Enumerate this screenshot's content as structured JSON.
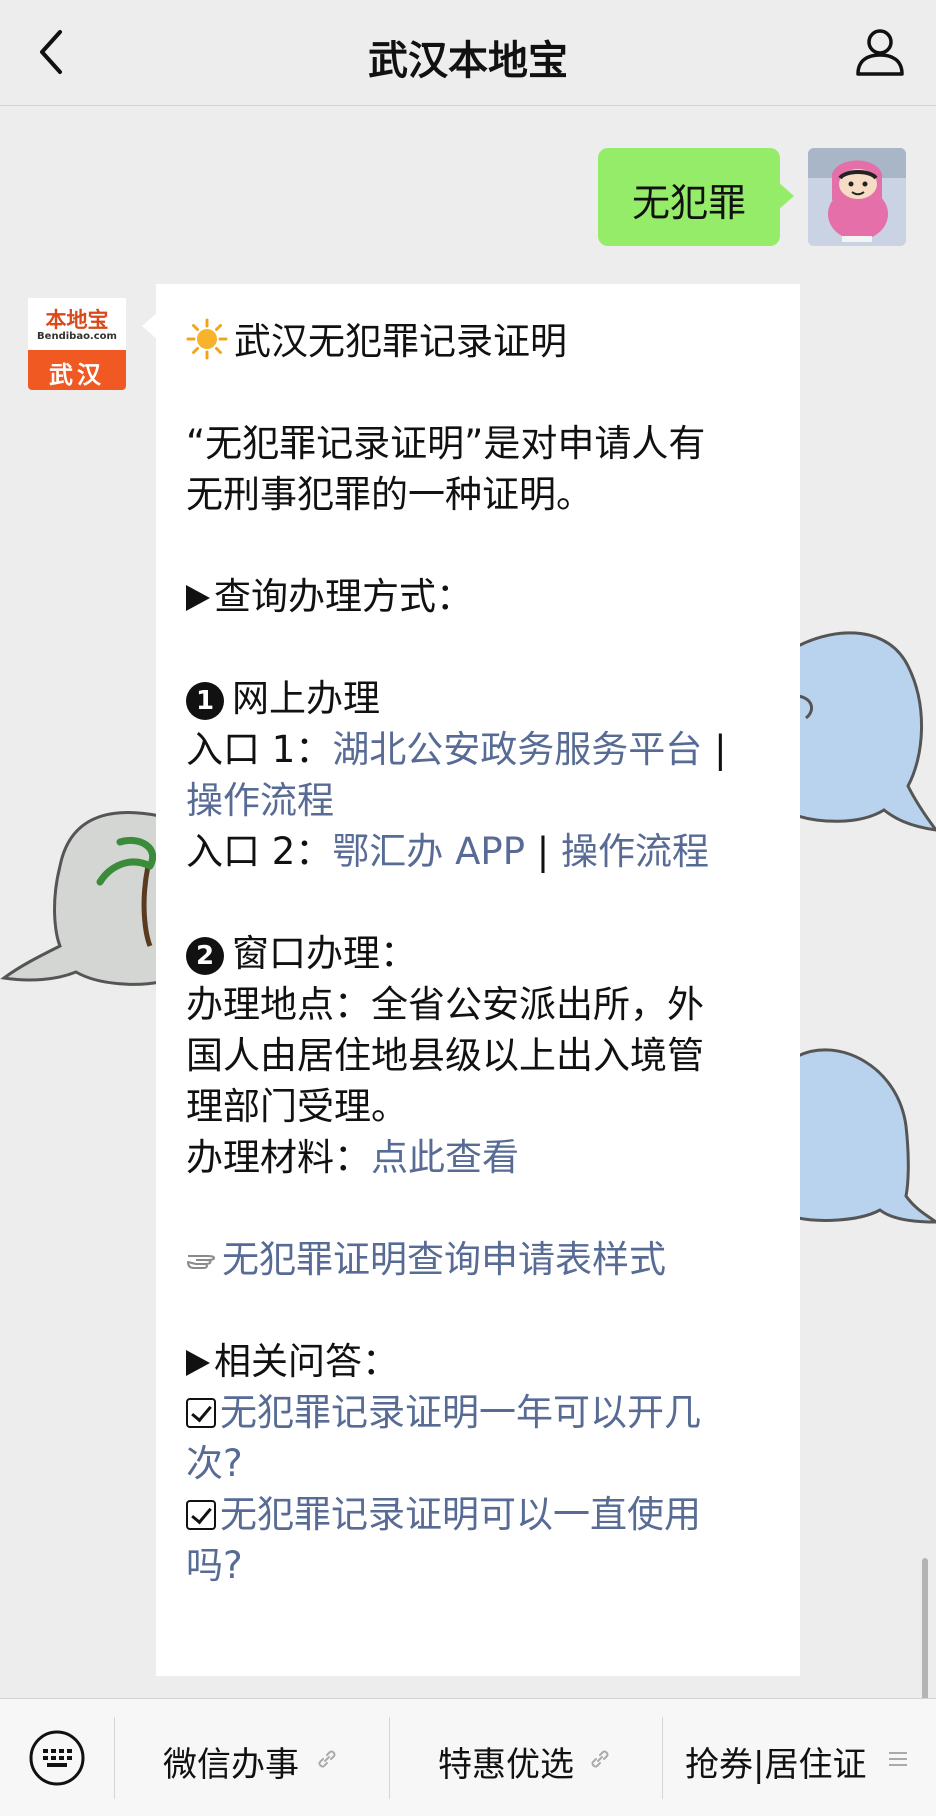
{
  "header": {
    "title": "武汉本地宝",
    "back_icon": "chevron-left-icon",
    "profile_icon": "person-icon"
  },
  "user_message": {
    "text": "无犯罪"
  },
  "bot_avatar": {
    "brand": "本地宝",
    "site": "Bendibao.com",
    "city": "武汉"
  },
  "bot_message": {
    "title": "武汉无犯罪记录证明",
    "intro_line1": "“无犯罪记录证明”是对申请人有",
    "intro_line2": "无刑事犯罪的一种证明。",
    "section_query": "查询办理方式：",
    "online_number": "1",
    "online_title": "网上办理",
    "entry1_prefix": "入口 1：",
    "entry1_link": "湖北公安政务服务平台",
    "entry1_sep": " |",
    "entry1_flow": "操作流程",
    "entry2_prefix": "入口 2：",
    "entry2_link": "鄂汇办 APP",
    "entry2_sep": " | ",
    "entry2_flow": "操作流程",
    "window_number": "2",
    "window_title": "窗口办理：",
    "location_line1": "办理地点：全省公安派出所，外",
    "location_line2": "国人由居住地县级以上出入境管",
    "location_line3": "理部门受理。",
    "material_prefix": "办理材料：",
    "material_link": "点此查看",
    "form_link": "无犯罪证明查询申请表样式",
    "section_faq": "相关问答：",
    "faq1_line1": "无犯罪记录证明一年可以开几",
    "faq1_line2": "次?",
    "faq2_line1": "无犯罪记录证明可以一直使用",
    "faq2_line2": "吗?"
  },
  "colors": {
    "link": "#576b95",
    "user_bubble": "#95ec69",
    "background": "#ededed",
    "brand_orange": "#f05a22"
  },
  "bottom_menu": {
    "keyboard_icon": "keyboard-icon",
    "items": [
      {
        "label": "微信办事",
        "icon": "link-icon"
      },
      {
        "label": "特惠优选",
        "icon": "link-icon"
      },
      {
        "label": "抢券|居住证",
        "icon": "menu-icon"
      }
    ]
  }
}
